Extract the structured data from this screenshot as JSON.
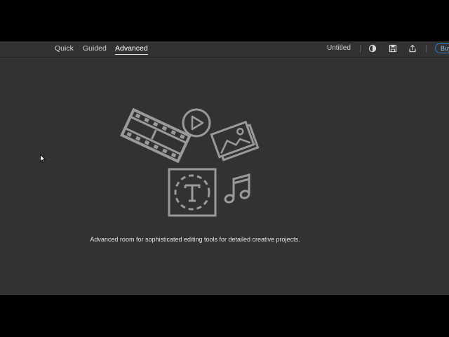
{
  "toolbar": {
    "tabs": [
      {
        "label": "Quick"
      },
      {
        "label": "Guided"
      },
      {
        "label": "Advanced",
        "active": true
      }
    ],
    "document_title": "Untitled",
    "buy_label": "Buy",
    "icons": [
      "mode-icon",
      "save-icon",
      "share-icon"
    ]
  },
  "main": {
    "description": "Advanced room for sophisticated editing tools for detailed creative projects.",
    "illustration_icons": [
      "film-strip-icon",
      "play-icon",
      "photos-icon",
      "text-icon",
      "music-note-icon"
    ]
  },
  "colors": {
    "background": "#323232",
    "toolbar_text": "#d2d2d2",
    "accent": "#2d83d8",
    "illustration_stroke": "#9a9a9a"
  }
}
